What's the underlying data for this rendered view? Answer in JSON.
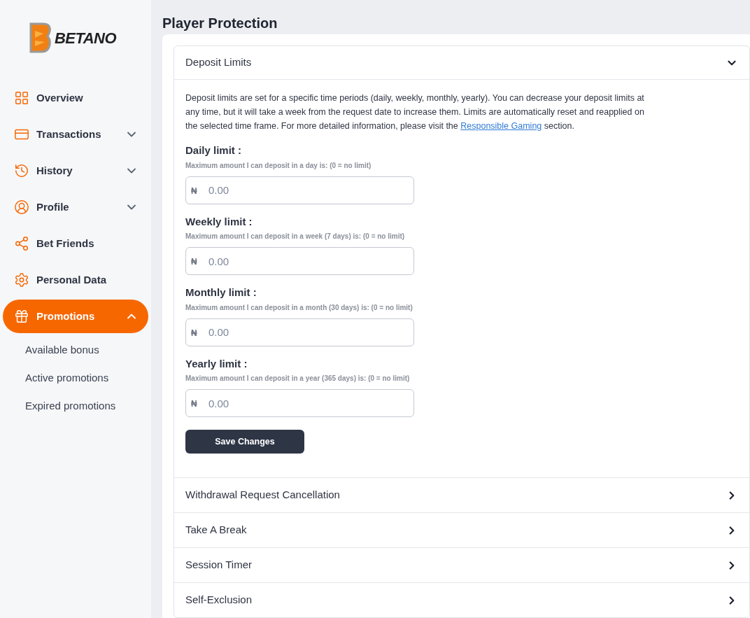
{
  "logo": {
    "text": "BETANO"
  },
  "sidebar": {
    "items": [
      {
        "kind": "overview",
        "label": "Overview",
        "selected": false
      },
      {
        "kind": "transactions",
        "label": "Transactions",
        "selected": false,
        "expanded": false
      },
      {
        "kind": "history",
        "label": "History",
        "selected": false,
        "expanded": false
      },
      {
        "kind": "profile",
        "label": "Profile",
        "selected": false,
        "expanded": false
      },
      {
        "kind": "friends",
        "label": "Bet Friends",
        "selected": false
      },
      {
        "kind": "personal",
        "label": "Personal Data",
        "selected": false
      },
      {
        "kind": "promotions",
        "label": "Promotions",
        "selected": true,
        "expanded": true,
        "children": [
          {
            "label": "Available bonus"
          },
          {
            "label": "Active promotions"
          },
          {
            "label": "Expired promotions"
          }
        ]
      }
    ]
  },
  "page": {
    "title": "Player Protection"
  },
  "sections": [
    {
      "title": "Deposit Limits",
      "expanded": true,
      "description": "Deposit limits are set for a specific time periods (daily, weekly, monthly, yearly). You can decrease your deposit limits at any time, but it will take a week from the request date to increase them. Limits are automatically reset and reapplied on the selected time frame. For more detailed information, please visit the",
      "link": "Responsible Gaming",
      "description_end": "section.",
      "fields": [
        {
          "label": "Daily limit :",
          "hint": "Maximum amount I can deposit in a day is: (0 = no limit)",
          "currency": "₦",
          "placeholder": "0.00"
        },
        {
          "label": "Weekly limit :",
          "hint": "Maximum amount I can deposit in a week (7 days) is: (0 = no limit)",
          "currency": "₦",
          "placeholder": "0.00"
        },
        {
          "label": "Monthly limit :",
          "hint": "Maximum amount I can deposit in a month (30 days) is: (0 = no limit)",
          "currency": "₦",
          "placeholder": "0.00"
        },
        {
          "label": "Yearly limit :",
          "hint": "Maximum amount I can deposit in a year (365 days) is: (0 = no limit)",
          "currency": "₦",
          "placeholder": "0.00"
        }
      ],
      "button": "Save Changes"
    },
    {
      "title": "Withdrawal Request Cancellation",
      "expanded": false
    },
    {
      "title": "Take A Break",
      "expanded": false
    },
    {
      "title": "Session Timer",
      "expanded": false
    },
    {
      "title": "Self-Exclusion",
      "expanded": false
    }
  ]
}
